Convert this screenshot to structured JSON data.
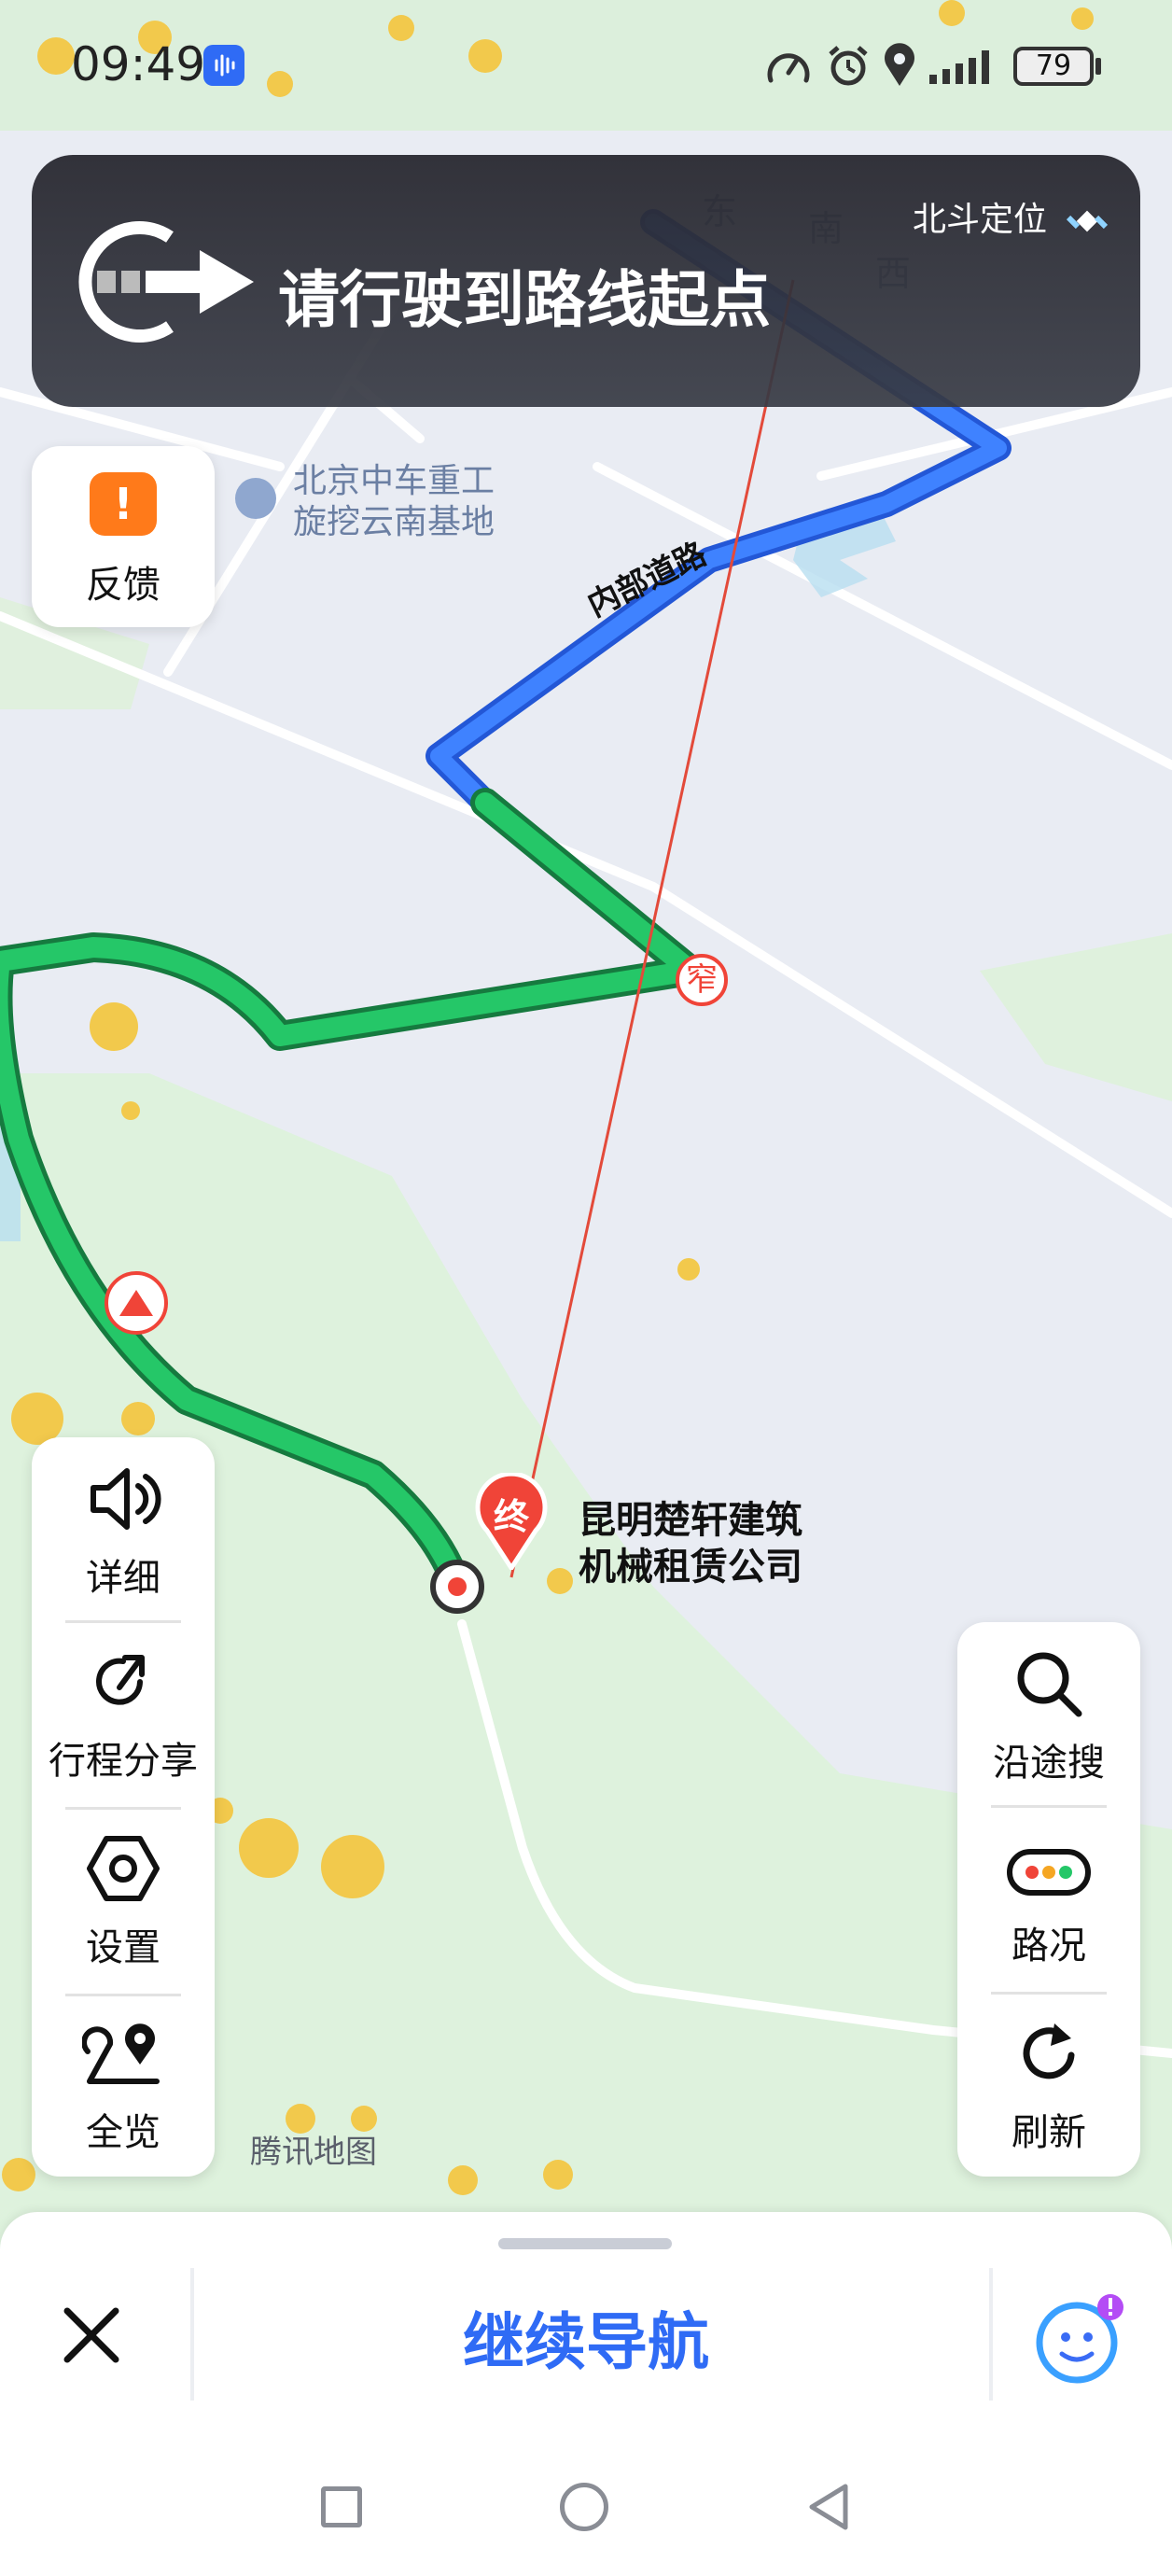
{
  "status_bar": {
    "time": "09:49",
    "battery": "79"
  },
  "nav_banner": {
    "instruction": "请行驶到路线起点",
    "positioning": "北斗定位"
  },
  "map": {
    "poi_factory_line1": "北京中车重工",
    "poi_factory_line2": "旋挖云南基地",
    "road_label": "内部道路",
    "narrow_marker": "窄",
    "destination_marker": "终",
    "destination_line1": "昆明楚轩建筑",
    "destination_line2": "机械租赁公司",
    "watermark": "腾讯地图",
    "street_chars": [
      "东",
      "南",
      "西"
    ]
  },
  "left_buttons": {
    "feedback": "反馈",
    "detail": "详细",
    "share_trip": "行程分享",
    "settings": "设置",
    "overview": "全览"
  },
  "right_buttons": {
    "search_along": "沿途搜",
    "traffic": "路况",
    "refresh": "刷新"
  },
  "bottom": {
    "continue": "继续导航"
  },
  "colors": {
    "route_blue": "#2f6bf5",
    "route_green": "#22c065",
    "accent_orange": "#ff7a1a",
    "marker_red": "#f04438"
  }
}
